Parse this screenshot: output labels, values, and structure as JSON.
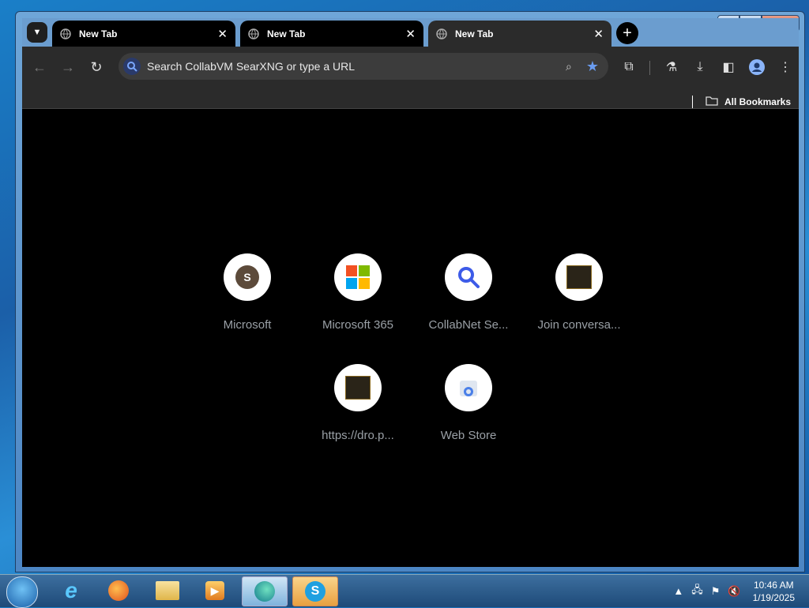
{
  "tabs": [
    {
      "label": "New Tab",
      "active": false
    },
    {
      "label": "New Tab",
      "active": false
    },
    {
      "label": "New Tab",
      "active": true
    }
  ],
  "omnibox": {
    "placeholder": "Search CollabVM SearXNG or type a URL"
  },
  "bookmarks": {
    "all_label": "All Bookmarks"
  },
  "shortcuts": [
    {
      "title": "Microsoft",
      "icon": "s-letter-icon"
    },
    {
      "title": "Microsoft 365",
      "icon": "microsoft-logo-icon"
    },
    {
      "title": "CollabNet Se...",
      "icon": "magnifier-icon"
    },
    {
      "title": "Join conversa...",
      "icon": "site-thumbnail-icon"
    },
    {
      "title": "https://dro.p...",
      "icon": "site-thumbnail-icon"
    },
    {
      "title": "Web Store",
      "icon": "web-store-icon"
    }
  ],
  "taskbar": {
    "time": "10:46 AM",
    "date": "1/19/2025"
  },
  "colors": {
    "accent": "#6a9cf0",
    "tab_active": "#2b2b2b",
    "page_bg": "#000000"
  }
}
